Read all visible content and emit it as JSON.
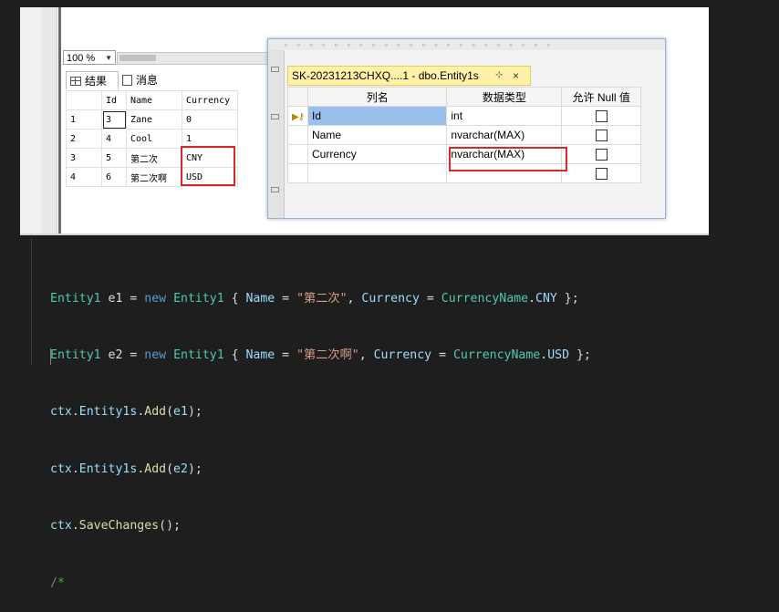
{
  "results_pane": {
    "zoom": "100 %",
    "tabs": [
      {
        "label": "结果",
        "active": true
      },
      {
        "label": "消息",
        "active": false
      }
    ],
    "columns": [
      "Id",
      "Name",
      "Currency"
    ],
    "rows": [
      {
        "row": "1",
        "Id": "3",
        "Name": "Zane",
        "Currency": "0"
      },
      {
        "row": "2",
        "Id": "4",
        "Name": "Cool",
        "Currency": "1"
      },
      {
        "row": "3",
        "Id": "5",
        "Name": "第二次",
        "Currency": "CNY"
      },
      {
        "row": "4",
        "Id": "6",
        "Name": "第二次啊",
        "Currency": "USD"
      }
    ]
  },
  "designer": {
    "document_tab": "SK-20231213CHXQ....1 - dbo.Entity1s",
    "pin_icon": "⊹",
    "close_icon": "×",
    "columns": [
      "列名",
      "数据类型",
      "允许 Null 值"
    ],
    "rows": [
      {
        "name": "Id",
        "type": "int",
        "allow_null": false,
        "primary_key": true
      },
      {
        "name": "Name",
        "type": "nvarchar(MAX)",
        "allow_null": false
      },
      {
        "name": "Currency",
        "type": "nvarchar(MAX)",
        "allow_null": false
      },
      {
        "name": "",
        "type": "",
        "allow_null": false
      }
    ]
  },
  "code": {
    "line1": {
      "type1": "Entity1",
      "var": "e1",
      "eq": "=",
      "kw": "new",
      "type2": "Entity1",
      "prop1": "Name",
      "str": "\"第二次\"",
      "prop2": "Currency",
      "enum": "CurrencyName",
      "member": "CNY"
    },
    "line2": {
      "type1": "Entity1",
      "var": "e2",
      "eq": "=",
      "kw": "new",
      "type2": "Entity1",
      "prop1": "Name",
      "str": "\"第二次啊\"",
      "prop2": "Currency",
      "enum": "CurrencyName",
      "member": "USD"
    },
    "line3": {
      "obj": "ctx",
      "prop": "Entity1s",
      "method": "Add",
      "arg": "e1"
    },
    "line4": {
      "obj": "ctx",
      "prop": "Entity1s",
      "method": "Add",
      "arg": "e2"
    },
    "line5": {
      "obj": "ctx",
      "method": "SaveChanges"
    },
    "line6": "/*"
  },
  "colors": {
    "editor_bg": "#1e1e1e",
    "keyword": "#569cd6",
    "type": "#4ec9b0",
    "string": "#d69d85",
    "highlight_box": "#d42a2a",
    "tab_active": "#fff1a8"
  }
}
